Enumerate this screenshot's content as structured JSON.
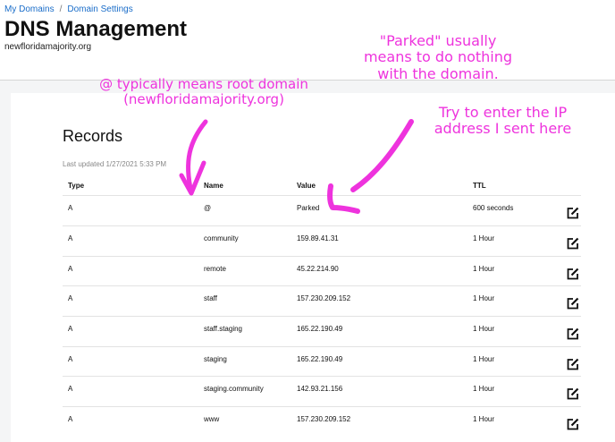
{
  "breadcrumb": {
    "items": [
      "My Domains",
      "Domain Settings"
    ],
    "separator": "/"
  },
  "page": {
    "title": "DNS Management",
    "domain": "newfloridamajority.org"
  },
  "records": {
    "heading": "Records",
    "last_updated": "Last updated 1/27/2021 5:33 PM",
    "columns": [
      "Type",
      "Name",
      "Value",
      "TTL"
    ],
    "rows": [
      {
        "type": "A",
        "name": "@",
        "value": "Parked",
        "ttl": "600 seconds"
      },
      {
        "type": "A",
        "name": "community",
        "value": "159.89.41.31",
        "ttl": "1 Hour"
      },
      {
        "type": "A",
        "name": "remote",
        "value": "45.22.214.90",
        "ttl": "1 Hour"
      },
      {
        "type": "A",
        "name": "staff",
        "value": "157.230.209.152",
        "ttl": "1 Hour"
      },
      {
        "type": "A",
        "name": "staff.staging",
        "value": "165.22.190.49",
        "ttl": "1 Hour"
      },
      {
        "type": "A",
        "name": "staging",
        "value": "165.22.190.49",
        "ttl": "1 Hour"
      },
      {
        "type": "A",
        "name": "staging.community",
        "value": "142.93.21.156",
        "ttl": "1 Hour"
      },
      {
        "type": "A",
        "name": "www",
        "value": "157.230.209.152",
        "ttl": "1 Hour"
      }
    ]
  },
  "annotations": {
    "root_domain": [
      "@ typically means root domain",
      "(newfloridamajority.org)"
    ],
    "parked": [
      "\"Parked\" usually",
      "means to do nothing",
      "with the domain."
    ],
    "ip_hint": [
      "Try to enter the IP",
      "address I sent here"
    ]
  },
  "icons": {
    "edit": "edit-icon"
  },
  "colors": {
    "annotation": "#ee33dd",
    "link": "#1a6dc9"
  }
}
